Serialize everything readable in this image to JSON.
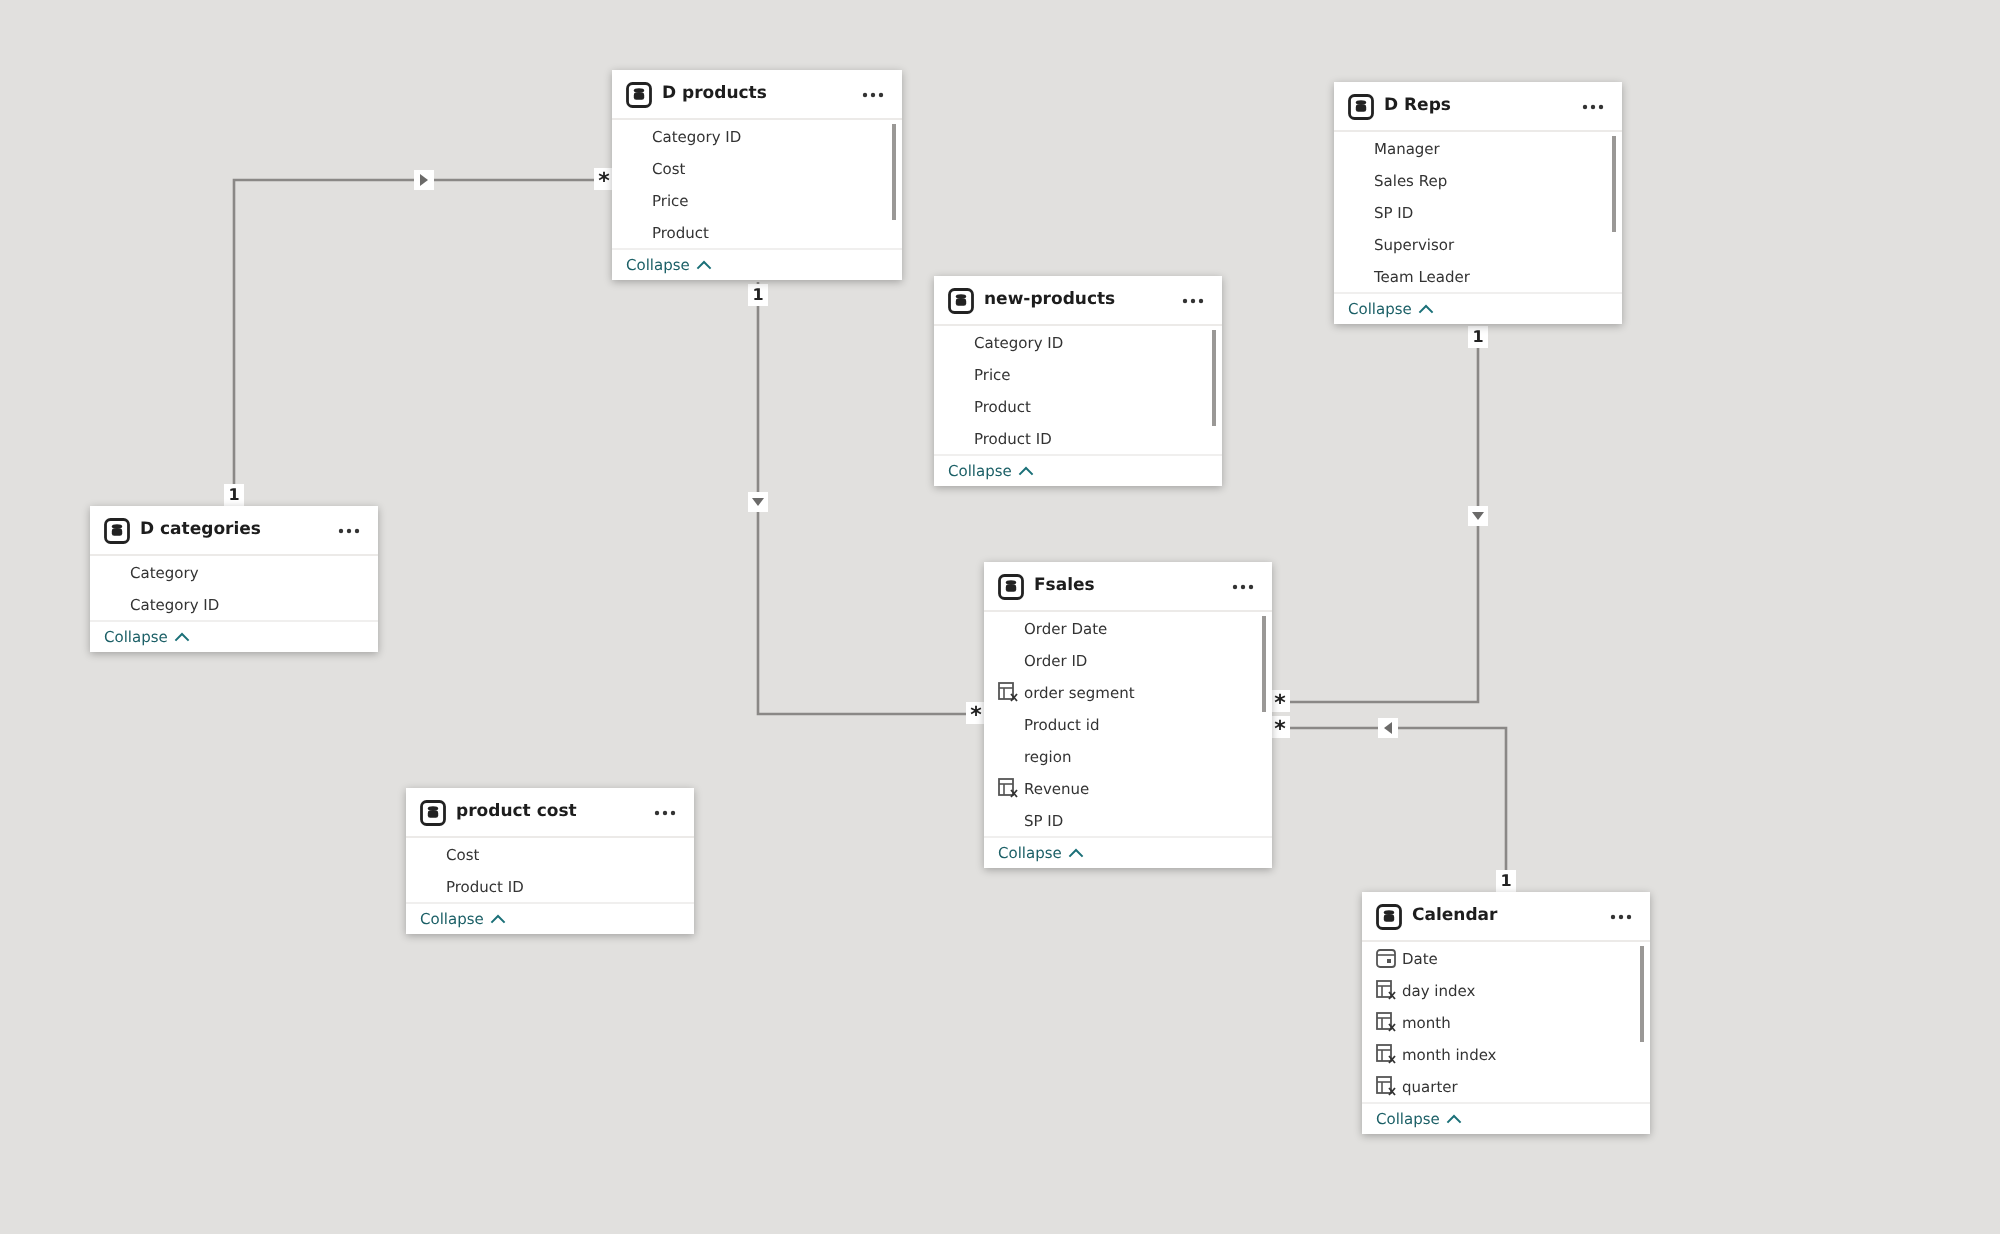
{
  "tables": [
    {
      "name": "D products",
      "scrollable": true,
      "fields": [
        {
          "name": "Category ID",
          "kind": "column"
        },
        {
          "name": "Cost",
          "kind": "column"
        },
        {
          "name": "Price",
          "kind": "column"
        },
        {
          "name": "Product",
          "kind": "column"
        }
      ],
      "footer": "Collapse"
    },
    {
      "name": "D Reps",
      "scrollable": true,
      "fields": [
        {
          "name": "Manager",
          "kind": "column"
        },
        {
          "name": "Sales Rep",
          "kind": "column"
        },
        {
          "name": "SP ID",
          "kind": "column"
        },
        {
          "name": "Supervisor",
          "kind": "column"
        },
        {
          "name": "Team Leader",
          "kind": "column"
        }
      ],
      "footer": "Collapse"
    },
    {
      "name": "new-products",
      "scrollable": true,
      "fields": [
        {
          "name": "Category ID",
          "kind": "column"
        },
        {
          "name": "Price",
          "kind": "column"
        },
        {
          "name": "Product",
          "kind": "column"
        },
        {
          "name": "Product ID",
          "kind": "column"
        }
      ],
      "footer": "Collapse"
    },
    {
      "name": "D categories",
      "scrollable": false,
      "fields": [
        {
          "name": "Category",
          "kind": "column"
        },
        {
          "name": "Category ID",
          "kind": "column"
        }
      ],
      "footer": "Collapse"
    },
    {
      "name": "Fsales",
      "scrollable": true,
      "fields": [
        {
          "name": "Order Date",
          "kind": "column"
        },
        {
          "name": "Order ID",
          "kind": "column"
        },
        {
          "name": "order segment",
          "kind": "calculated"
        },
        {
          "name": "Product id",
          "kind": "column"
        },
        {
          "name": "region",
          "kind": "column"
        },
        {
          "name": "Revenue",
          "kind": "calculated"
        },
        {
          "name": "SP ID",
          "kind": "column"
        }
      ],
      "footer": "Collapse"
    },
    {
      "name": "product cost",
      "scrollable": false,
      "fields": [
        {
          "name": "Cost",
          "kind": "column"
        },
        {
          "name": "Product ID",
          "kind": "column"
        }
      ],
      "footer": "Collapse"
    },
    {
      "name": "Calendar",
      "scrollable": true,
      "fields": [
        {
          "name": "Date",
          "kind": "date"
        },
        {
          "name": "day index",
          "kind": "calculated"
        },
        {
          "name": "month",
          "kind": "calculated"
        },
        {
          "name": "month index",
          "kind": "calculated"
        },
        {
          "name": "quarter",
          "kind": "calculated"
        }
      ],
      "footer": "Collapse"
    }
  ],
  "relationships": [
    {
      "one_label": "1",
      "many_label": "*",
      "kind": "right"
    },
    {
      "one_label": "1",
      "many_label": "*",
      "kind": "down"
    },
    {
      "one_label": "1",
      "many_label": "*",
      "kind": "down"
    },
    {
      "one_label": "1",
      "many_label": "*",
      "kind": "left"
    }
  ]
}
